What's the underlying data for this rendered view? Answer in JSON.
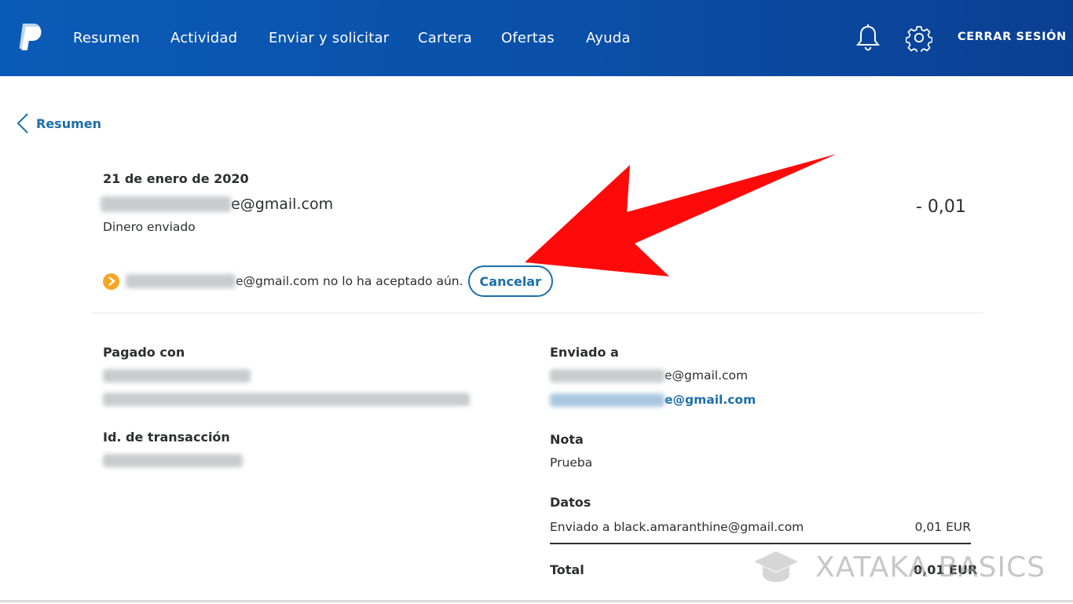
{
  "nav": {
    "items": [
      {
        "label": "Resumen"
      },
      {
        "label": "Actividad"
      },
      {
        "label": "Enviar y solicitar"
      },
      {
        "label": "Cartera"
      },
      {
        "label": "Ofertas"
      },
      {
        "label": "Ayuda"
      }
    ],
    "logout_label": "CERRAR SESIÓN",
    "icons": [
      "paypal-logo",
      "bell-icon",
      "gear-icon"
    ]
  },
  "back": {
    "label": "Resumen"
  },
  "transaction": {
    "date": "21 de enero de 2020",
    "recipient_suffix": "e@gmail.com",
    "type": "Dinero enviado",
    "amount": "- 0,01",
    "pending_text": "e@gmail.com no lo ha aceptado aún.",
    "cancel_label": "Cancelar"
  },
  "paid_with": {
    "label": "Pagado con"
  },
  "transaction_id": {
    "label": "Id. de transacción"
  },
  "sent_to": {
    "label": "Enviado a",
    "email_suffix": "e@gmail.com",
    "link_suffix": "e@gmail.com"
  },
  "note": {
    "label": "Nota",
    "value": "Prueba"
  },
  "details": {
    "label": "Datos",
    "row_label": "Enviado a black.amaranthine@gmail.com",
    "row_value": "0,01 EUR"
  },
  "total": {
    "label": "Total",
    "value": "0,01 EUR"
  },
  "watermark": {
    "text": "XATAKA BASICS"
  },
  "colors": {
    "brand_blue": "#0a5bb7",
    "link": "#1b6eaa",
    "pending": "#f5a623",
    "arrow": "#ff0000"
  }
}
